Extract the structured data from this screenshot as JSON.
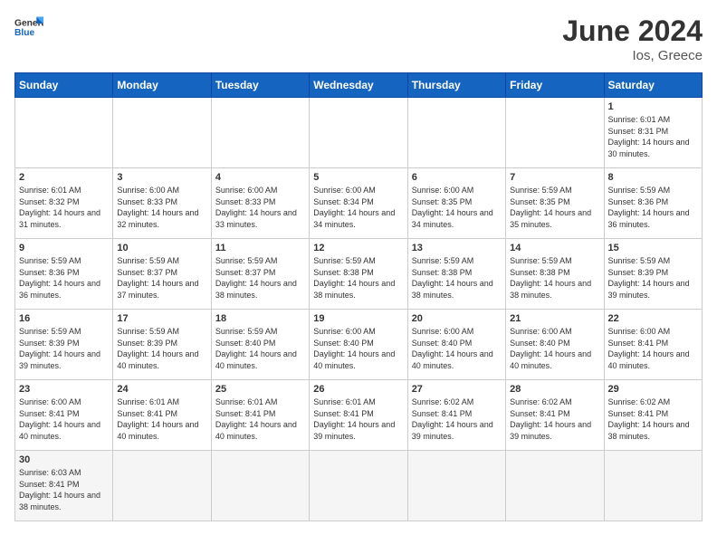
{
  "header": {
    "logo_general": "General",
    "logo_blue": "Blue",
    "title": "June 2024",
    "location": "Ios, Greece"
  },
  "weekdays": [
    "Sunday",
    "Monday",
    "Tuesday",
    "Wednesday",
    "Thursday",
    "Friday",
    "Saturday"
  ],
  "weeks": [
    [
      {
        "day": "",
        "info": ""
      },
      {
        "day": "",
        "info": ""
      },
      {
        "day": "",
        "info": ""
      },
      {
        "day": "",
        "info": ""
      },
      {
        "day": "",
        "info": ""
      },
      {
        "day": "",
        "info": ""
      },
      {
        "day": "1",
        "info": "Sunrise: 6:01 AM\nSunset: 8:31 PM\nDaylight: 14 hours and 30 minutes."
      }
    ],
    [
      {
        "day": "2",
        "info": "Sunrise: 6:01 AM\nSunset: 8:32 PM\nDaylight: 14 hours and 31 minutes."
      },
      {
        "day": "3",
        "info": "Sunrise: 6:00 AM\nSunset: 8:33 PM\nDaylight: 14 hours and 32 minutes."
      },
      {
        "day": "4",
        "info": "Sunrise: 6:00 AM\nSunset: 8:33 PM\nDaylight: 14 hours and 33 minutes."
      },
      {
        "day": "5",
        "info": "Sunrise: 6:00 AM\nSunset: 8:34 PM\nDaylight: 14 hours and 34 minutes."
      },
      {
        "day": "6",
        "info": "Sunrise: 6:00 AM\nSunset: 8:35 PM\nDaylight: 14 hours and 34 minutes."
      },
      {
        "day": "7",
        "info": "Sunrise: 5:59 AM\nSunset: 8:35 PM\nDaylight: 14 hours and 35 minutes."
      },
      {
        "day": "8",
        "info": "Sunrise: 5:59 AM\nSunset: 8:36 PM\nDaylight: 14 hours and 36 minutes."
      }
    ],
    [
      {
        "day": "9",
        "info": "Sunrise: 5:59 AM\nSunset: 8:36 PM\nDaylight: 14 hours and 36 minutes."
      },
      {
        "day": "10",
        "info": "Sunrise: 5:59 AM\nSunset: 8:37 PM\nDaylight: 14 hours and 37 minutes."
      },
      {
        "day": "11",
        "info": "Sunrise: 5:59 AM\nSunset: 8:37 PM\nDaylight: 14 hours and 38 minutes."
      },
      {
        "day": "12",
        "info": "Sunrise: 5:59 AM\nSunset: 8:38 PM\nDaylight: 14 hours and 38 minutes."
      },
      {
        "day": "13",
        "info": "Sunrise: 5:59 AM\nSunset: 8:38 PM\nDaylight: 14 hours and 38 minutes."
      },
      {
        "day": "14",
        "info": "Sunrise: 5:59 AM\nSunset: 8:38 PM\nDaylight: 14 hours and 38 minutes."
      },
      {
        "day": "15",
        "info": "Sunrise: 5:59 AM\nSunset: 8:39 PM\nDaylight: 14 hours and 39 minutes."
      }
    ],
    [
      {
        "day": "16",
        "info": "Sunrise: 5:59 AM\nSunset: 8:39 PM\nDaylight: 14 hours and 39 minutes."
      },
      {
        "day": "17",
        "info": "Sunrise: 5:59 AM\nSunset: 8:39 PM\nDaylight: 14 hours and 40 minutes."
      },
      {
        "day": "18",
        "info": "Sunrise: 5:59 AM\nSunset: 8:40 PM\nDaylight: 14 hours and 40 minutes."
      },
      {
        "day": "19",
        "info": "Sunrise: 6:00 AM\nSunset: 8:40 PM\nDaylight: 14 hours and 40 minutes."
      },
      {
        "day": "20",
        "info": "Sunrise: 6:00 AM\nSunset: 8:40 PM\nDaylight: 14 hours and 40 minutes."
      },
      {
        "day": "21",
        "info": "Sunrise: 6:00 AM\nSunset: 8:40 PM\nDaylight: 14 hours and 40 minutes."
      },
      {
        "day": "22",
        "info": "Sunrise: 6:00 AM\nSunset: 8:41 PM\nDaylight: 14 hours and 40 minutes."
      }
    ],
    [
      {
        "day": "23",
        "info": "Sunrise: 6:00 AM\nSunset: 8:41 PM\nDaylight: 14 hours and 40 minutes."
      },
      {
        "day": "24",
        "info": "Sunrise: 6:01 AM\nSunset: 8:41 PM\nDaylight: 14 hours and 40 minutes."
      },
      {
        "day": "25",
        "info": "Sunrise: 6:01 AM\nSunset: 8:41 PM\nDaylight: 14 hours and 40 minutes."
      },
      {
        "day": "26",
        "info": "Sunrise: 6:01 AM\nSunset: 8:41 PM\nDaylight: 14 hours and 39 minutes."
      },
      {
        "day": "27",
        "info": "Sunrise: 6:02 AM\nSunset: 8:41 PM\nDaylight: 14 hours and 39 minutes."
      },
      {
        "day": "28",
        "info": "Sunrise: 6:02 AM\nSunset: 8:41 PM\nDaylight: 14 hours and 39 minutes."
      },
      {
        "day": "29",
        "info": "Sunrise: 6:02 AM\nSunset: 8:41 PM\nDaylight: 14 hours and 38 minutes."
      }
    ],
    [
      {
        "day": "30",
        "info": "Sunrise: 6:03 AM\nSunset: 8:41 PM\nDaylight: 14 hours and 38 minutes."
      },
      {
        "day": "",
        "info": ""
      },
      {
        "day": "",
        "info": ""
      },
      {
        "day": "",
        "info": ""
      },
      {
        "day": "",
        "info": ""
      },
      {
        "day": "",
        "info": ""
      },
      {
        "day": "",
        "info": ""
      }
    ]
  ]
}
